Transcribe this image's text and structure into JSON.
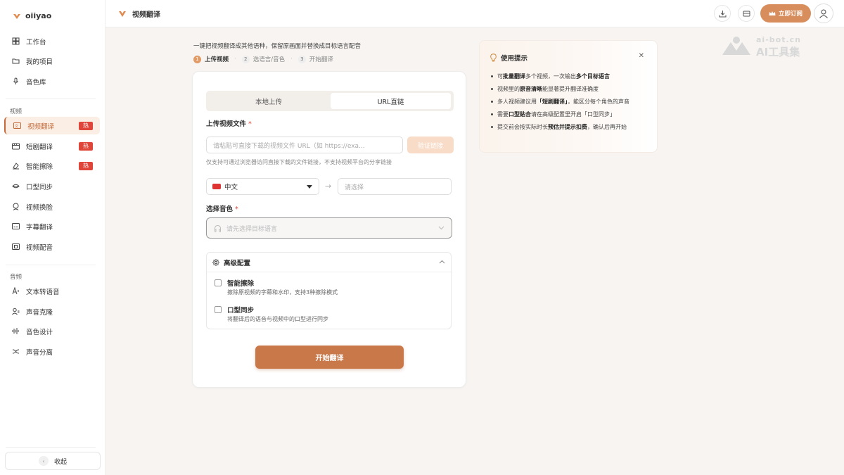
{
  "brand": {
    "name": "oiiyao",
    "color": "#c46a3a"
  },
  "sidebar": {
    "items_top": [
      {
        "label": "工作台",
        "icon": "grid-icon"
      },
      {
        "label": "我的项目",
        "icon": "folder-icon"
      },
      {
        "label": "音色库",
        "icon": "microphone-icon"
      }
    ],
    "video_section_label": "视频",
    "items_video": [
      {
        "label": "视频翻译",
        "icon": "video-translate-icon",
        "badge": "热",
        "active": true
      },
      {
        "label": "短剧翻译",
        "icon": "clapper-icon",
        "badge": "热"
      },
      {
        "label": "智能擦除",
        "icon": "eraser-icon",
        "badge": "热"
      },
      {
        "label": "口型同步",
        "icon": "lips-icon"
      },
      {
        "label": "视频换脸",
        "icon": "face-swap-icon"
      },
      {
        "label": "字幕翻译",
        "icon": "subtitle-icon"
      },
      {
        "label": "视频配音",
        "icon": "film-icon"
      }
    ],
    "audio_section_label": "音频",
    "items_audio": [
      {
        "label": "文本转语音",
        "icon": "text-to-speech-icon"
      },
      {
        "label": "声音克隆",
        "icon": "user-voice-icon"
      },
      {
        "label": "音色设计",
        "icon": "waveform-icon"
      },
      {
        "label": "声音分离",
        "icon": "split-icon"
      }
    ],
    "collapse_label": "收起"
  },
  "header": {
    "title": "视频翻译",
    "subscribe_label": "立即订阅",
    "accent": "#d88d5c"
  },
  "main": {
    "intro": "一键把视频翻译成其他语种，保留原画面并替换成目标语言配音",
    "steps": [
      {
        "num": "1",
        "label": "上传视频",
        "active": true
      },
      {
        "num": "2",
        "label": "选语言/音色"
      },
      {
        "num": "3",
        "label": "开始翻译"
      }
    ],
    "tabs": [
      {
        "label": "本地上传"
      },
      {
        "label": "URL直链",
        "selected": true
      }
    ],
    "upload_label": "上传视频文件",
    "required_mark": "*",
    "url_placeholder": "请粘贴可直接下载的视频文件 URL（如 https://exa...",
    "verify_label": "验证链接",
    "url_hint": "仅支持可通过浏览器访问直接下载的文件链接，不支持视频平台的分享链接",
    "source_lang": "中文",
    "target_placeholder": "请选择",
    "voice_label": "选择音色",
    "voice_placeholder": "请先选择目标语言",
    "advanced": {
      "title": "高级配置",
      "options": [
        {
          "title": "智能擦除",
          "desc": "擦除原视频的字幕和水印，支持3种擦除模式",
          "checked": false
        },
        {
          "title": "口型同步",
          "desc": "将翻译后的语音与视频中的口型进行同步",
          "checked": false
        }
      ]
    },
    "start_label": "开始翻译",
    "start_color": "#c9784a"
  },
  "tips": {
    "title": "使用提示",
    "items": [
      [
        "可",
        "批量翻译",
        "多个视频，一次输出",
        "多个目标语言",
        ""
      ],
      [
        "视频里的",
        "原音清晰",
        "能显著提升翻译准确度",
        "",
        ""
      ],
      [
        "多人视频建议用",
        "「短剧翻译」",
        "，能区分每个角色的声音",
        "",
        ""
      ],
      [
        "需要",
        "口型贴合",
        "请在高级配置里开启「口型同步」",
        "",
        ""
      ],
      [
        "提交前会按实际时长",
        "预估并提示扣费",
        "，确认后再开始",
        "",
        ""
      ]
    ]
  },
  "watermark": {
    "top": "ai-bot.cn",
    "bottom": "AI工具集"
  }
}
